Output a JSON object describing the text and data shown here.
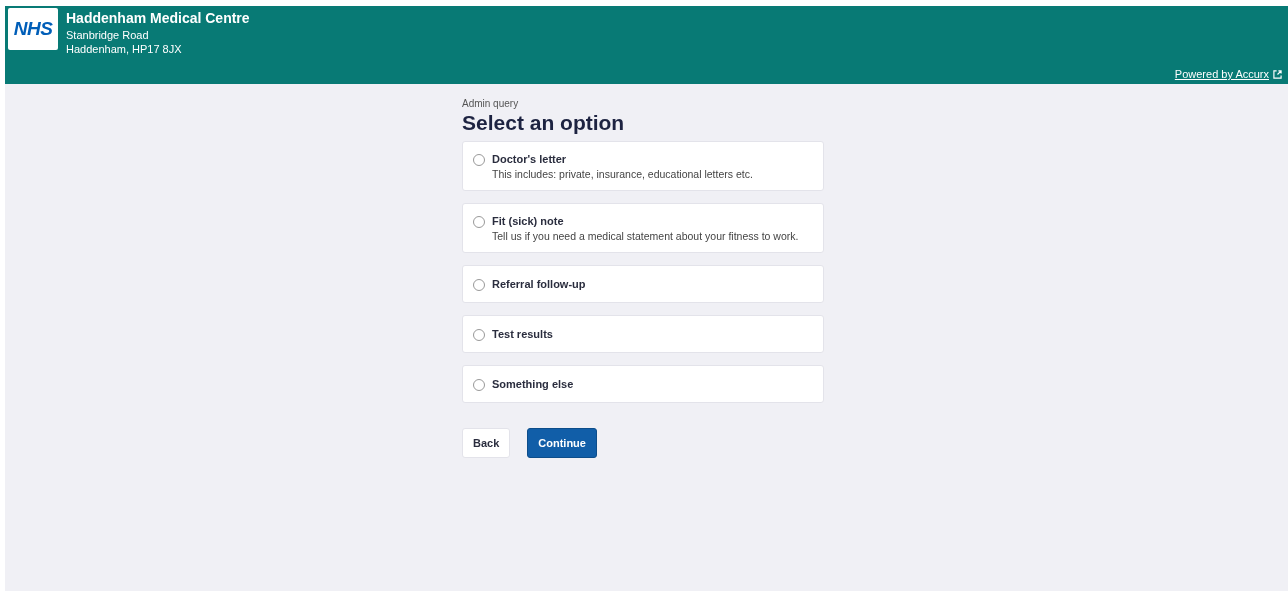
{
  "header": {
    "logo": "NHS",
    "practice_name": "Haddenham Medical Centre",
    "address_lines": [
      "Stanbridge Road",
      "Haddenham, HP17 8JX"
    ],
    "powered_link": "Powered by Accurx"
  },
  "form": {
    "eyebrow": "Admin query",
    "title": "Select an option",
    "options": [
      {
        "label": "Doctor's letter",
        "description": "This includes: private, insurance, educational letters etc.",
        "selected": false
      },
      {
        "label": "Fit (sick) note",
        "description": "Tell us if you need a medical statement about your fitness to work.",
        "selected": false
      },
      {
        "label": "Referral follow-up",
        "selected": false
      },
      {
        "label": "Test results",
        "selected": false
      },
      {
        "label": "Something else",
        "selected": false
      }
    ],
    "buttons": [
      {
        "label": "Back",
        "kind": "secondary"
      },
      {
        "label": "Continue",
        "kind": "primary"
      }
    ]
  }
}
